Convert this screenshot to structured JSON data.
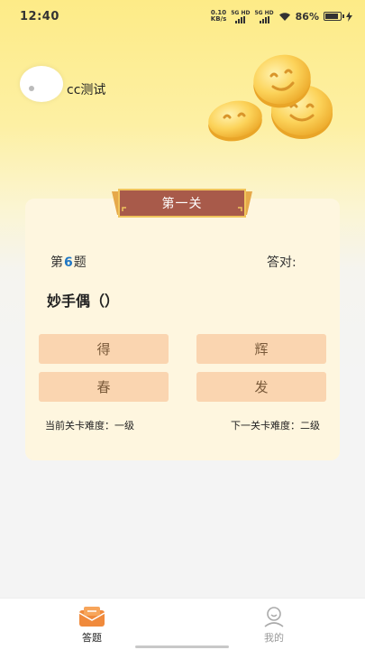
{
  "status_bar": {
    "time": "12:40",
    "net_speed_value": "0.10",
    "net_speed_unit": "KB/s",
    "sim1_label": "5G HD",
    "sim2_label": "5G HD",
    "wifi_icon": "wifi-icon",
    "battery_percent": "86%",
    "battery_level": 0.86,
    "charging_icon": "charging-bolt-icon"
  },
  "profile": {
    "username": "cc测试"
  },
  "card": {
    "banner_title": "第一关",
    "question_prefix": "第",
    "question_number": "6",
    "question_suffix": "题",
    "correct_label": "答对:",
    "question_text": "妙手偶（）",
    "options": [
      "得",
      "辉",
      "春",
      "发"
    ],
    "current_difficulty": "当前关卡难度：一级",
    "next_difficulty": "下一关卡难度：二级"
  },
  "bottom_nav": {
    "items": [
      {
        "label": "答题",
        "icon": "quiz-envelope-icon",
        "active": true
      },
      {
        "label": "我的",
        "icon": "profile-icon",
        "active": false
      }
    ]
  },
  "colors": {
    "accent": "#f08a3c",
    "banner": "#a85a4a",
    "option_bg": "#fad5b0",
    "card_bg": "#fef6df",
    "question_number": "#1f76c4"
  }
}
